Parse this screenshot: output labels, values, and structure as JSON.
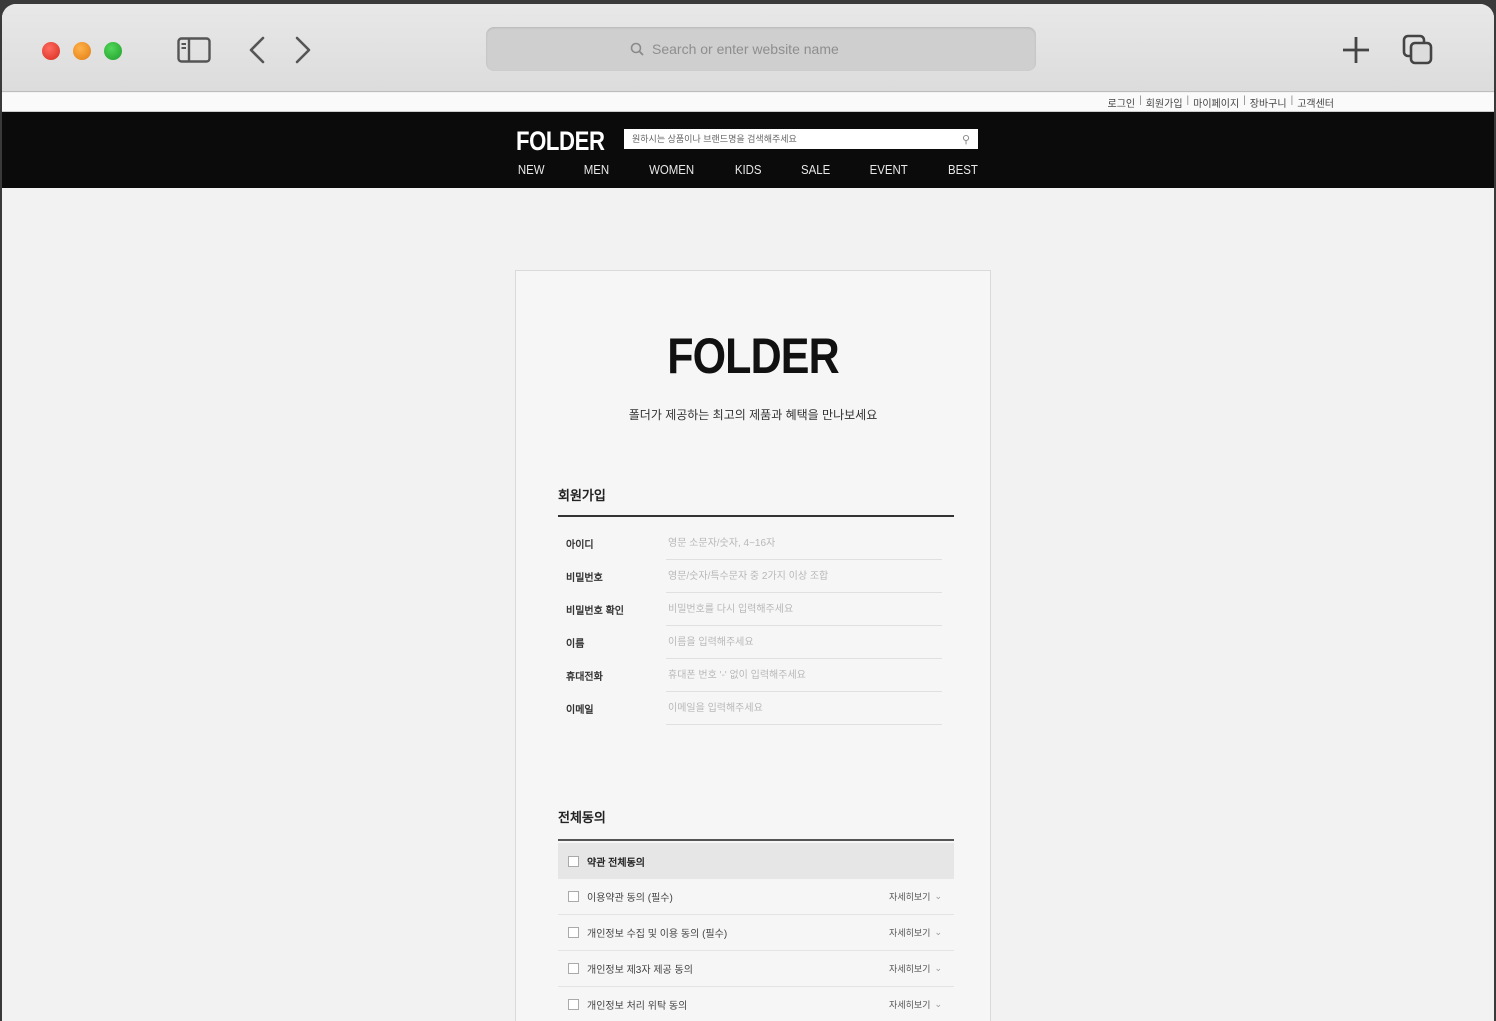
{
  "browser": {
    "address_placeholder": "Search or enter website name"
  },
  "utility_links": [
    "로그인",
    "회원가입",
    "마이페이지",
    "장바구니",
    "고객센터"
  ],
  "site": {
    "logo": "FOLDER",
    "search_placeholder": "원하시는 상품이나 브랜드명을 검색해주세요",
    "nav": [
      "NEW",
      "MEN",
      "WOMEN",
      "KIDS",
      "SALE",
      "EVENT",
      "BEST"
    ]
  },
  "signup": {
    "logo": "FOLDER",
    "tagline": "폴더가 제공하는 최고의 제품과 혜택을 만나보세요",
    "section_title": "회원가입",
    "fields": [
      {
        "label": "아이디",
        "placeholder": "영문 소문자/숫자, 4~16자"
      },
      {
        "label": "비밀번호",
        "placeholder": "영문/숫자/특수문자 중 2가지 이상 조합"
      },
      {
        "label": "비밀번호 확인",
        "placeholder": "비밀번호를 다시 입력해주세요"
      },
      {
        "label": "이름",
        "placeholder": "이름을 입력해주세요"
      },
      {
        "label": "휴대전화",
        "placeholder": "휴대폰 번호 '-' 없이 입력해주세요"
      },
      {
        "label": "이메일",
        "placeholder": "이메일을 입력해주세요"
      }
    ],
    "agree_title": "전체동의",
    "agree_all": "약관 전체동의",
    "agreements": [
      {
        "label": "이용약관 동의 (필수)",
        "more": "자세히보기"
      },
      {
        "label": "개인정보 수집 및 이용 동의 (필수)",
        "more": "자세히보기"
      },
      {
        "label": "개인정보 제3자 제공 동의",
        "more": "자세히보기"
      },
      {
        "label": "개인정보 처리 위탁 동의",
        "more": "자세히보기"
      }
    ]
  }
}
